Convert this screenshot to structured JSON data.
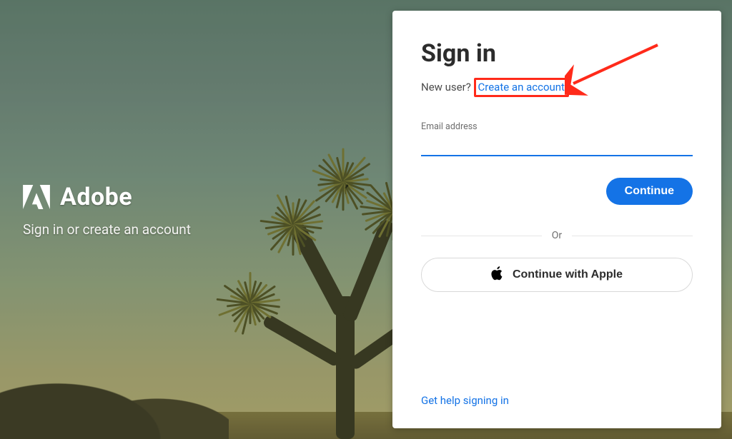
{
  "brand": {
    "name": "Adobe",
    "tagline": "Sign in or create an account"
  },
  "card": {
    "title": "Sign in",
    "new_user_prefix": "New user? ",
    "create_account_link": "Create an account",
    "email_label": "Email address",
    "email_value": "",
    "continue_label": "Continue",
    "divider_label": "Or",
    "apple_label": "Continue with Apple",
    "help_link_label": "Get help signing in"
  },
  "colors": {
    "accent": "#1473e6",
    "annotation": "#ff2a1a"
  }
}
